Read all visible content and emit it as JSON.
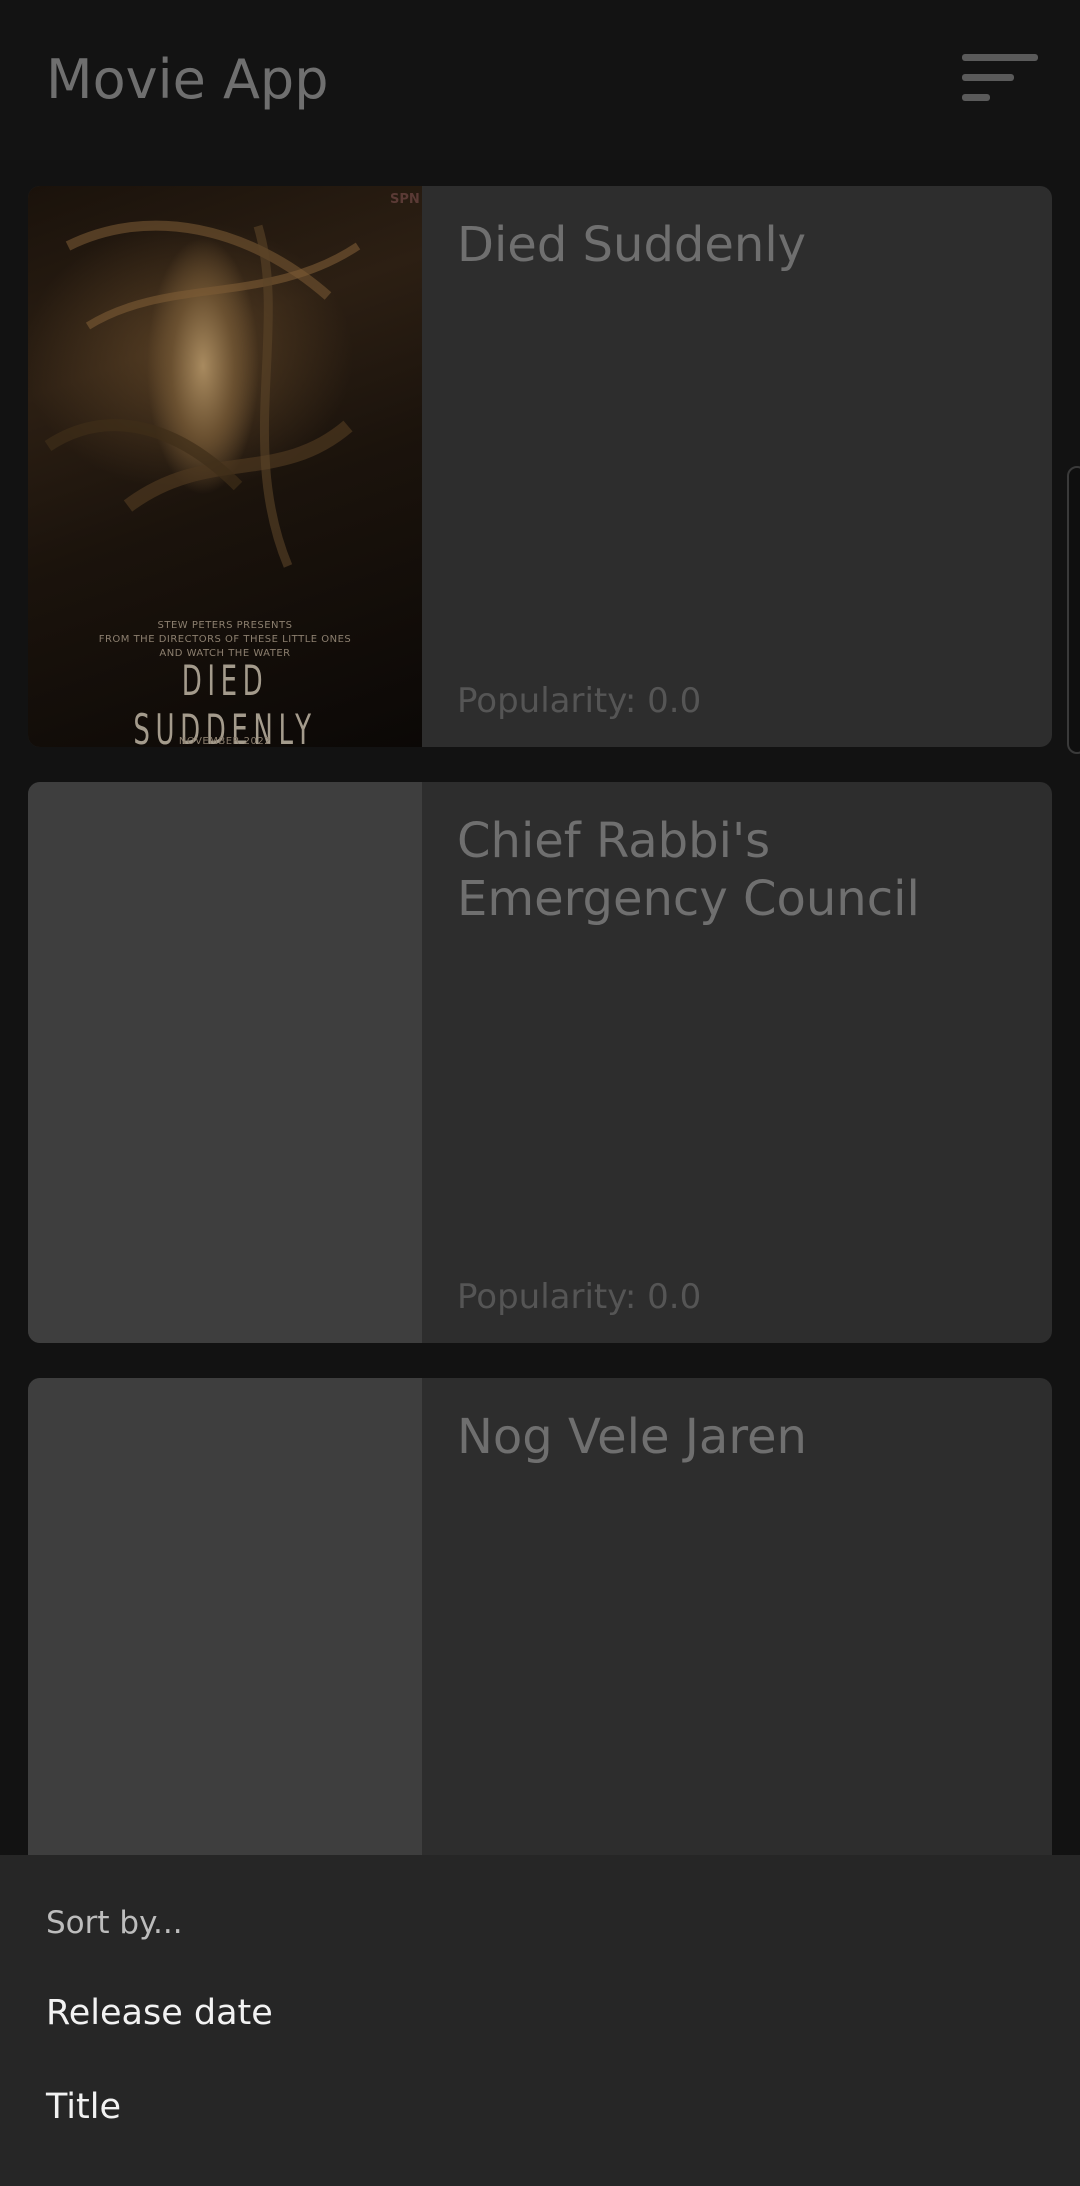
{
  "app_bar": {
    "title": "Movie App",
    "sort_icon": "sort-icon"
  },
  "movies": [
    {
      "title": "Died Suddenly",
      "popularity": "Popularity: 0.0",
      "has_poster": true,
      "poster_text": {
        "logo": "SPN",
        "line1": "STEW PETERS PRESENTS",
        "line2": "FROM THE DIRECTORS OF THESE LITTLE ONES",
        "line3": "AND WATCH THE WATER",
        "big_title": "DIED SUDDENLY",
        "date": "NOVEMBER 2022"
      }
    },
    {
      "title": "Chief Rabbi's Emergency Council",
      "popularity": "Popularity: 0.0",
      "has_poster": false
    },
    {
      "title": "Nog Vele Jaren",
      "has_poster": false
    }
  ],
  "sort_sheet": {
    "header": "Sort by...",
    "options": [
      "Release date",
      "Title"
    ]
  },
  "colors": {
    "background": "#121212",
    "card": "#2d2d2d",
    "poster_placeholder": "#3e3e3e",
    "sheet": "#262626"
  }
}
